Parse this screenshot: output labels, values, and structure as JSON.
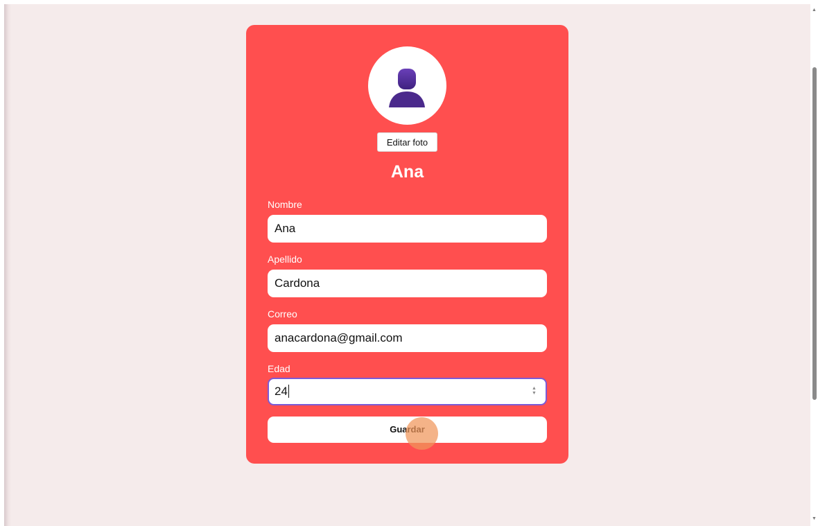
{
  "profile": {
    "edit_photo_label": "Editar foto",
    "display_name": "Ana",
    "avatar_icon": "user-avatar-icon"
  },
  "form": {
    "fields": [
      {
        "label": "Nombre",
        "value": "Ana"
      },
      {
        "label": "Apellido",
        "value": "Cardona"
      },
      {
        "label": "Correo",
        "value": "anacardona@gmail.com"
      },
      {
        "label": "Edad",
        "value": "24"
      }
    ],
    "save_label": "Guardar"
  },
  "colors": {
    "card": "#ff4f4f",
    "page_background": "#f5ebeb",
    "focus_ring": "#7b5ad6",
    "avatar_figure": "#4b2a8c"
  }
}
